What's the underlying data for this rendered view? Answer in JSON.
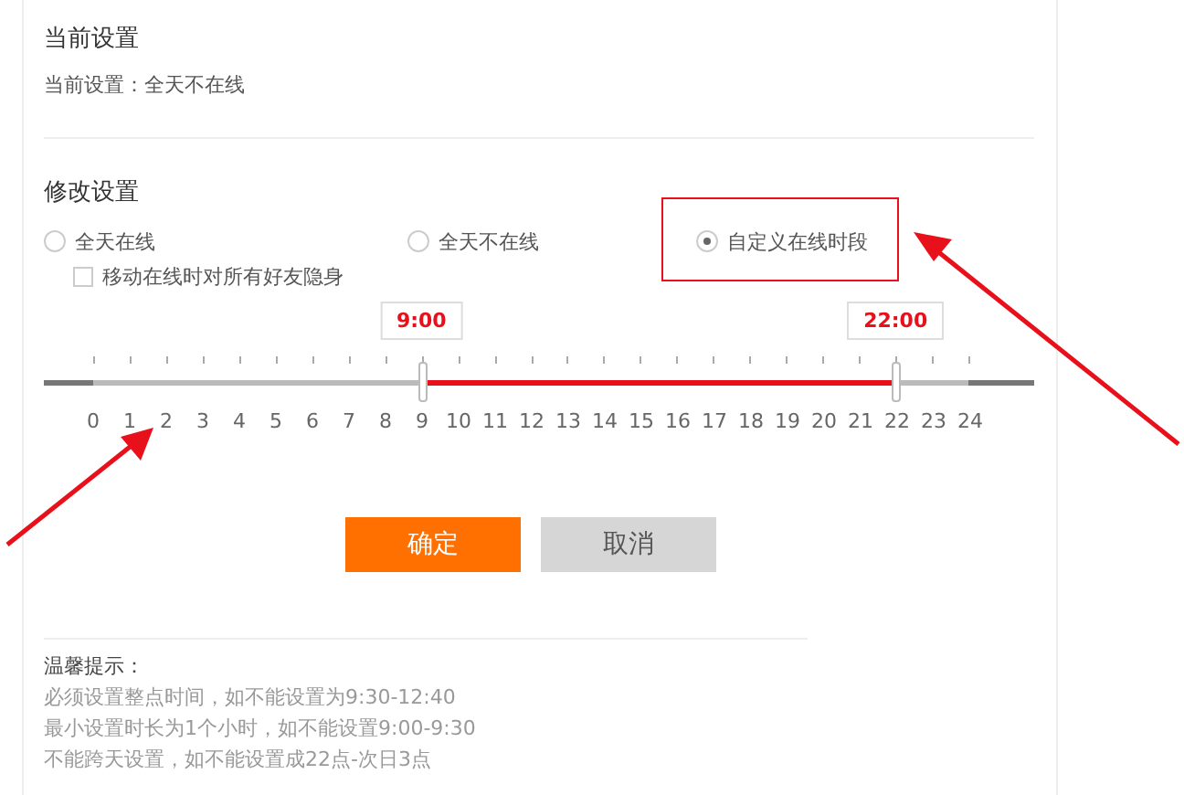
{
  "current": {
    "title": "当前设置",
    "text": "当前设置：全天不在线"
  },
  "modify": {
    "title": "修改设置",
    "options": [
      {
        "label": "全天在线",
        "selected": false,
        "highlighted": false
      },
      {
        "label": "全天不在线",
        "selected": false,
        "highlighted": false
      },
      {
        "label": "自定义在线时段",
        "selected": true,
        "highlighted": true
      }
    ],
    "stealth": {
      "label": "移动在线时对所有好友隐身",
      "checked": false
    },
    "slider": {
      "handles": [
        {
          "label": "9:00",
          "level": 0.375
        },
        {
          "label": "22:00",
          "level": 0.9167
        }
      ],
      "scale": [
        "0",
        "1",
        "2",
        "3",
        "4",
        "5",
        "6",
        "7",
        "8",
        "9",
        "10",
        "11",
        "12",
        "13",
        "14",
        "15",
        "16",
        "17",
        "18",
        "19",
        "20",
        "21",
        "22",
        "23",
        "24"
      ]
    }
  },
  "buttons": [
    {
      "label": "确定",
      "kind": "primary"
    },
    {
      "label": "取消",
      "kind": "secondary"
    }
  ],
  "tips": {
    "title": "温馨提示：",
    "lines": [
      "必须设置整点时间，如不能设置为9:30-12:40",
      "最小设置时长为1个小时，如不能设置9:00-9:30",
      "不能跨天设置，如不能设置成22点-次日3点"
    ]
  }
}
